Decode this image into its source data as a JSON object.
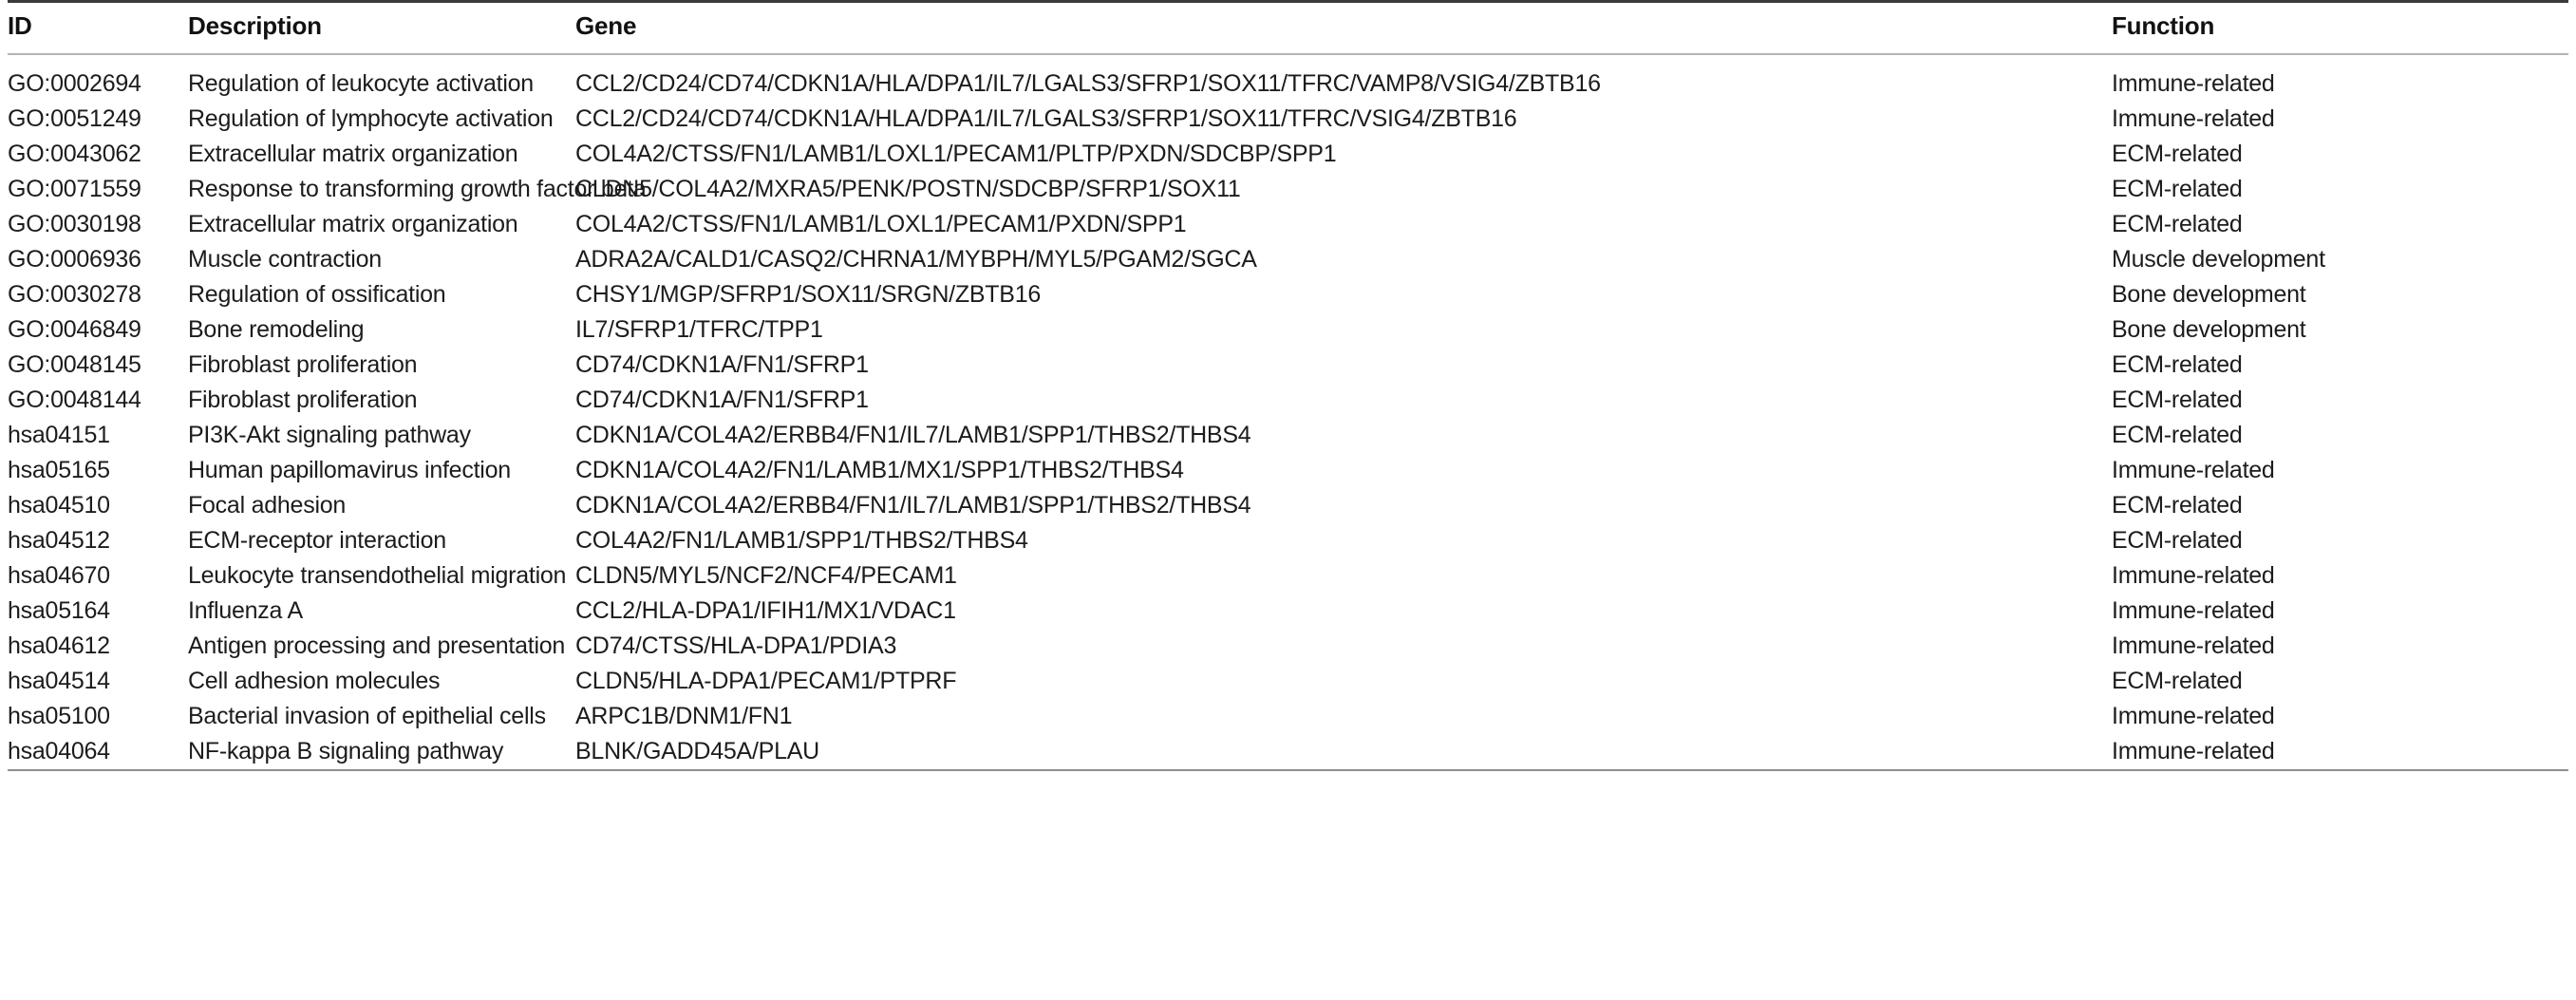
{
  "table": {
    "columns": [
      {
        "key": "id",
        "label": "ID"
      },
      {
        "key": "description",
        "label": "Description"
      },
      {
        "key": "gene",
        "label": "Gene"
      },
      {
        "key": "function",
        "label": "Function"
      }
    ],
    "rows": [
      {
        "id": "GO:0002694",
        "description": "Regulation of leukocyte activation",
        "gene": "CCL2/CD24/CD74/CDKN1A/HLA/DPA1/IL7/LGALS3/SFRP1/SOX11/TFRC/VAMP8/VSIG4/ZBTB16",
        "function": "Immune-related"
      },
      {
        "id": "GO:0051249",
        "description": "Regulation of lymphocyte activation",
        "gene": "CCL2/CD24/CD74/CDKN1A/HLA/DPA1/IL7/LGALS3/SFRP1/SOX11/TFRC/VSIG4/ZBTB16",
        "function": "Immune-related"
      },
      {
        "id": "GO:0043062",
        "description": "Extracellular matrix organization",
        "gene": "COL4A2/CTSS/FN1/LAMB1/LOXL1/PECAM1/PLTP/PXDN/SDCBP/SPP1",
        "function": "ECM-related"
      },
      {
        "id": "GO:0071559",
        "description": "Response to transforming growth factor beta",
        "gene": "CLDN5/COL4A2/MXRA5/PENK/POSTN/SDCBP/SFRP1/SOX11",
        "function": "ECM-related"
      },
      {
        "id": "GO:0030198",
        "description": "Extracellular matrix organization",
        "gene": "COL4A2/CTSS/FN1/LAMB1/LOXL1/PECAM1/PXDN/SPP1",
        "function": "ECM-related"
      },
      {
        "id": "GO:0006936",
        "description": "Muscle contraction",
        "gene": "ADRA2A/CALD1/CASQ2/CHRNA1/MYBPH/MYL5/PGAM2/SGCA",
        "function": "Muscle development"
      },
      {
        "id": "GO:0030278",
        "description": "Regulation of ossification",
        "gene": "CHSY1/MGP/SFRP1/SOX11/SRGN/ZBTB16",
        "function": "Bone development"
      },
      {
        "id": "GO:0046849",
        "description": "Bone remodeling",
        "gene": "IL7/SFRP1/TFRC/TPP1",
        "function": "Bone development"
      },
      {
        "id": "GO:0048145",
        "description": "Fibroblast proliferation",
        "gene": "CD74/CDKN1A/FN1/SFRP1",
        "function": "ECM-related"
      },
      {
        "id": "GO:0048144",
        "description": "Fibroblast proliferation",
        "gene": "CD74/CDKN1A/FN1/SFRP1",
        "function": "ECM-related"
      },
      {
        "id": "hsa04151",
        "description": "PI3K-Akt signaling pathway",
        "gene": "CDKN1A/COL4A2/ERBB4/FN1/IL7/LAMB1/SPP1/THBS2/THBS4",
        "function": "ECM-related"
      },
      {
        "id": "hsa05165",
        "description": "Human papillomavirus infection",
        "gene": "CDKN1A/COL4A2/FN1/LAMB1/MX1/SPP1/THBS2/THBS4",
        "function": "Immune-related"
      },
      {
        "id": "hsa04510",
        "description": "Focal adhesion",
        "gene": "CDKN1A/COL4A2/ERBB4/FN1/IL7/LAMB1/SPP1/THBS2/THBS4",
        "function": "ECM-related"
      },
      {
        "id": "hsa04512",
        "description": "ECM-receptor interaction",
        "gene": "COL4A2/FN1/LAMB1/SPP1/THBS2/THBS4",
        "function": "ECM-related"
      },
      {
        "id": "hsa04670",
        "description": "Leukocyte transendothelial migration",
        "gene": "CLDN5/MYL5/NCF2/NCF4/PECAM1",
        "function": "Immune-related"
      },
      {
        "id": "hsa05164",
        "description": "Influenza A",
        "gene": "CCL2/HLA-DPA1/IFIH1/MX1/VDAC1",
        "function": "Immune-related"
      },
      {
        "id": "hsa04612",
        "description": "Antigen processing and presentation",
        "gene": "CD74/CTSS/HLA-DPA1/PDIA3",
        "function": "Immune-related"
      },
      {
        "id": "hsa04514",
        "description": "Cell adhesion molecules",
        "gene": "CLDN5/HLA-DPA1/PECAM1/PTPRF",
        "function": "ECM-related"
      },
      {
        "id": "hsa05100",
        "description": "Bacterial invasion of epithelial cells",
        "gene": "ARPC1B/DNM1/FN1",
        "function": "Immune-related"
      },
      {
        "id": "hsa04064",
        "description": "NF-kappa B signaling pathway",
        "gene": "BLNK/GADD45A/PLAU",
        "function": "Immune-related"
      }
    ]
  }
}
